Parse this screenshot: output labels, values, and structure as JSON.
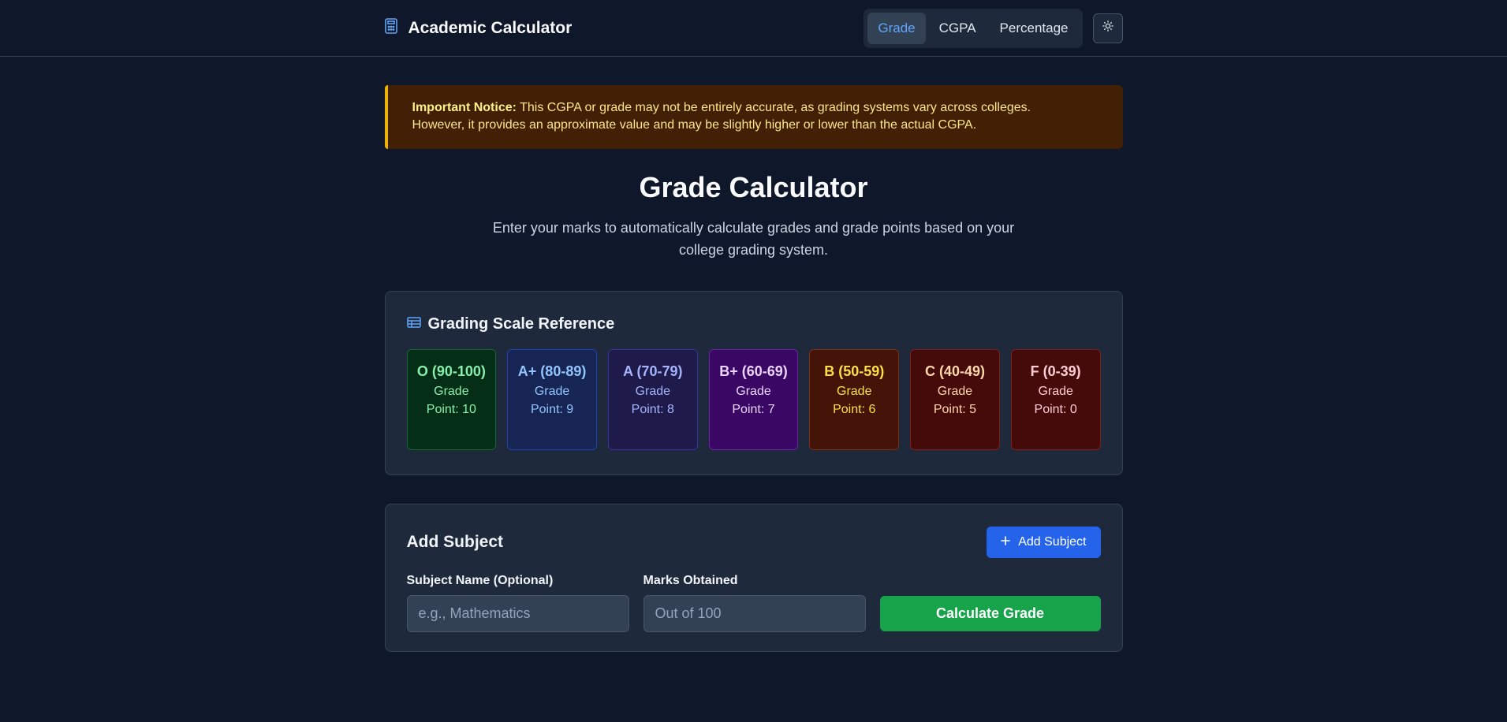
{
  "header": {
    "app_title": "Academic Calculator",
    "tabs": [
      {
        "label": "Grade",
        "active": true
      },
      {
        "label": "CGPA",
        "active": false
      },
      {
        "label": "Percentage",
        "active": false
      }
    ],
    "theme_toggle_icon": "sun-icon"
  },
  "notice": {
    "label": "Important Notice:",
    "text_line1": " This CGPA or grade may not be entirely accurate, as grading systems vary across colleges.",
    "text_line2": "However, it provides an approximate value and may be slightly higher or lower than the actual CGPA."
  },
  "main": {
    "title": "Grade Calculator",
    "subtitle": "Enter your marks to automatically calculate grades and grade points based on your college grading system."
  },
  "scale": {
    "title": "Grading Scale Reference",
    "grades": [
      {
        "name": "O (90-100)",
        "point": "Grade Point: 10",
        "bg": "#052e16",
        "border": "#166534",
        "color": "#86efac"
      },
      {
        "name": "A+ (80-89)",
        "point": "Grade Point: 9",
        "bg": "#172554",
        "border": "#1e40af",
        "color": "#93c5fd"
      },
      {
        "name": "A (70-79)",
        "point": "Grade Point: 8",
        "bg": "#1e1b4b",
        "border": "#3730a3",
        "color": "#a5b4fc"
      },
      {
        "name": "B+ (60-69)",
        "point": "Grade Point: 7",
        "bg": "#3b0764",
        "border": "#6b21a8",
        "color": "#e9d5ff"
      },
      {
        "name": "B (50-59)",
        "point": "Grade Point: 6",
        "bg": "#431407",
        "border": "#7c2d12",
        "color": "#fde047"
      },
      {
        "name": "C (40-49)",
        "point": "Grade Point: 5",
        "bg": "#450a0a",
        "border": "#7f1d1d",
        "color": "#fed7aa"
      },
      {
        "name": "F (0-39)",
        "point": "Grade Point: 0",
        "bg": "#450a0a",
        "border": "#7f1d1d",
        "color": "#fecdd3"
      }
    ]
  },
  "add": {
    "title": "Add Subject",
    "add_button": "Add Subject",
    "subject_label": "Subject Name (Optional)",
    "subject_placeholder": "e.g., Mathematics",
    "subject_value": "",
    "marks_label": "Marks Obtained",
    "marks_placeholder": "Out of 100",
    "marks_value": "",
    "calculate_button": "Calculate Grade"
  }
}
